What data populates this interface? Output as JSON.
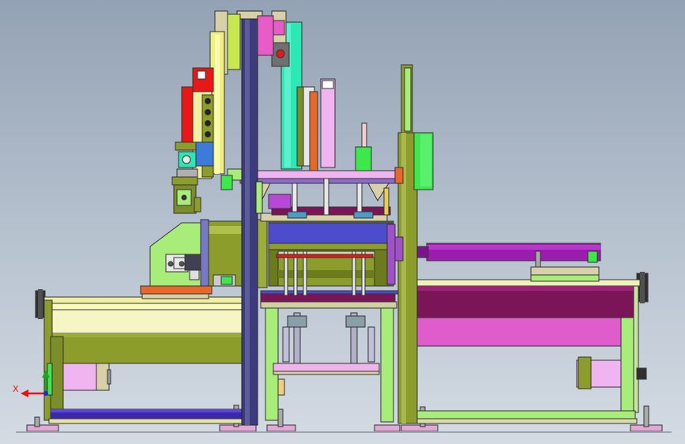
{
  "viewport": {
    "background_top": "#93a2b4",
    "background_bottom": "#d4dbe3"
  },
  "triad": {
    "x_label": "X",
    "x_color": "#e8141c",
    "y_color": "#18a818",
    "z_color": "#1c28e0"
  },
  "colors": {
    "olive": "#8c9d2c",
    "light_yellow": "#fafabf",
    "lime": "#a8ec7a",
    "magenta": "#e85cc8",
    "purple": "#8c1ca8",
    "maroon": "#7c1458",
    "navy_column": "#3c3c7c",
    "teal": "#2ce8b4",
    "pink": "#f0a0e8",
    "blue_bar": "#3c28b0",
    "red": "#e81818",
    "orange": "#e8682c",
    "green_panel": "#3ce84c",
    "dark_gray": "#404040"
  }
}
